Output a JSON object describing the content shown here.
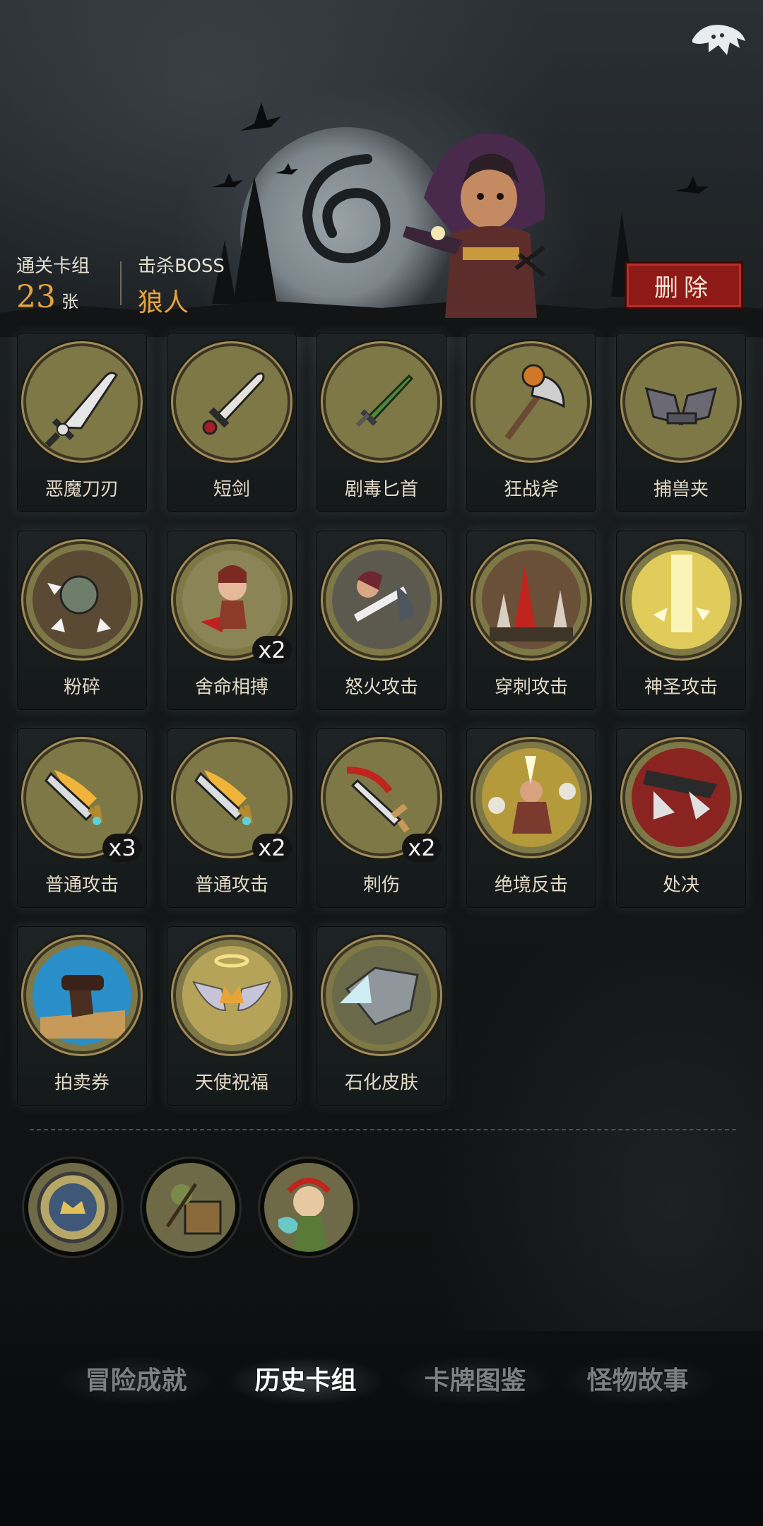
{
  "header": {
    "cleared_decks_label": "通关卡组",
    "cleared_decks_count": "23",
    "cleared_decks_unit": "张",
    "boss_label": "击杀BOSS",
    "boss_name": "狼人",
    "delete_label": "删除"
  },
  "cards": [
    {
      "name": "恶魔刀刃",
      "icon": "demon-blade-icon",
      "count": ""
    },
    {
      "name": "短剑",
      "icon": "short-sword-icon",
      "count": ""
    },
    {
      "name": "剧毒匕首",
      "icon": "poison-dagger-icon",
      "count": ""
    },
    {
      "name": "狂战斧",
      "icon": "berserker-axe-icon",
      "count": ""
    },
    {
      "name": "捕兽夹",
      "icon": "bear-trap-icon",
      "count": ""
    },
    {
      "name": "粉碎",
      "icon": "smash-icon",
      "count": ""
    },
    {
      "name": "舍命相搏",
      "icon": "desperate-fight-icon",
      "count": "x2"
    },
    {
      "name": "怒火攻击",
      "icon": "fury-attack-icon",
      "count": ""
    },
    {
      "name": "穿刺攻击",
      "icon": "pierce-attack-icon",
      "count": ""
    },
    {
      "name": "神圣攻击",
      "icon": "holy-attack-icon",
      "count": ""
    },
    {
      "name": "普通攻击",
      "icon": "normal-attack-icon",
      "count": "x3"
    },
    {
      "name": "普通攻击",
      "icon": "normal-attack-icon",
      "count": "x2"
    },
    {
      "name": "刺伤",
      "icon": "stab-icon",
      "count": "x2"
    },
    {
      "name": "绝境反击",
      "icon": "counterattack-icon",
      "count": ""
    },
    {
      "name": "处决",
      "icon": "execute-icon",
      "count": ""
    },
    {
      "name": "拍卖券",
      "icon": "auction-ticket-icon",
      "count": ""
    },
    {
      "name": "天使祝福",
      "icon": "angel-blessing-icon",
      "count": ""
    },
    {
      "name": "石化皮肤",
      "icon": "stone-skin-icon",
      "count": ""
    }
  ],
  "relics": [
    {
      "icon": "coin-crown-icon"
    },
    {
      "icon": "goblin-cart-icon"
    },
    {
      "icon": "dryad-icon"
    }
  ],
  "tabs": [
    {
      "label": "冒险成就",
      "active": false
    },
    {
      "label": "历史卡组",
      "active": true
    },
    {
      "label": "卡牌图鉴",
      "active": false
    },
    {
      "label": "怪物故事",
      "active": false
    }
  ],
  "colors": {
    "accent_gold": "#e8a43a",
    "delete_red": "#8e1a17",
    "disc_olive": "#7e7847"
  }
}
